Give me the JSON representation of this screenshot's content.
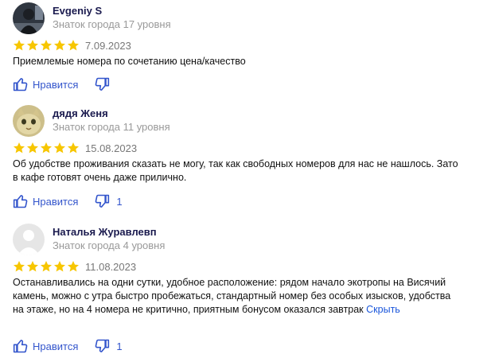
{
  "colors": {
    "star": "#f7c600",
    "link": "#1a56db",
    "action": "#3355cc",
    "meta": "#999999"
  },
  "reviews": [
    {
      "author": "Evgeniy S",
      "level": "Знаток города 17 уровня",
      "rating": 5,
      "date": "7.09.2023",
      "text": "Приемлемые номера по сочетанию цена/качество",
      "like_label": "Нравится",
      "dislike_count": ""
    },
    {
      "author": "дядя Женя",
      "level": "Знаток города 11 уровня",
      "rating": 5,
      "date": "15.08.2023",
      "text": "Об удобстве проживания сказать не могу, так как свободных номеров для нас не нашлось. Зато в кафе готовят очень даже прилично.",
      "like_label": "Нравится",
      "dislike_count": "1"
    },
    {
      "author": "Наталья Журавлевп",
      "level": "Знаток города 4 уровня",
      "rating": 5,
      "date": "11.08.2023",
      "text": "Останавливались на одни сутки, удобное расположение: рядом начало экотропы на Висячий камень, можно с утра быстро пробежаться, стандартный номер без особых изысков, удобства на этаже, но на 4 номера не критично, приятным бонусом оказался завтрак",
      "collapse_link": "Скрыть",
      "like_label": "Нравится",
      "dislike_count": "1"
    }
  ]
}
